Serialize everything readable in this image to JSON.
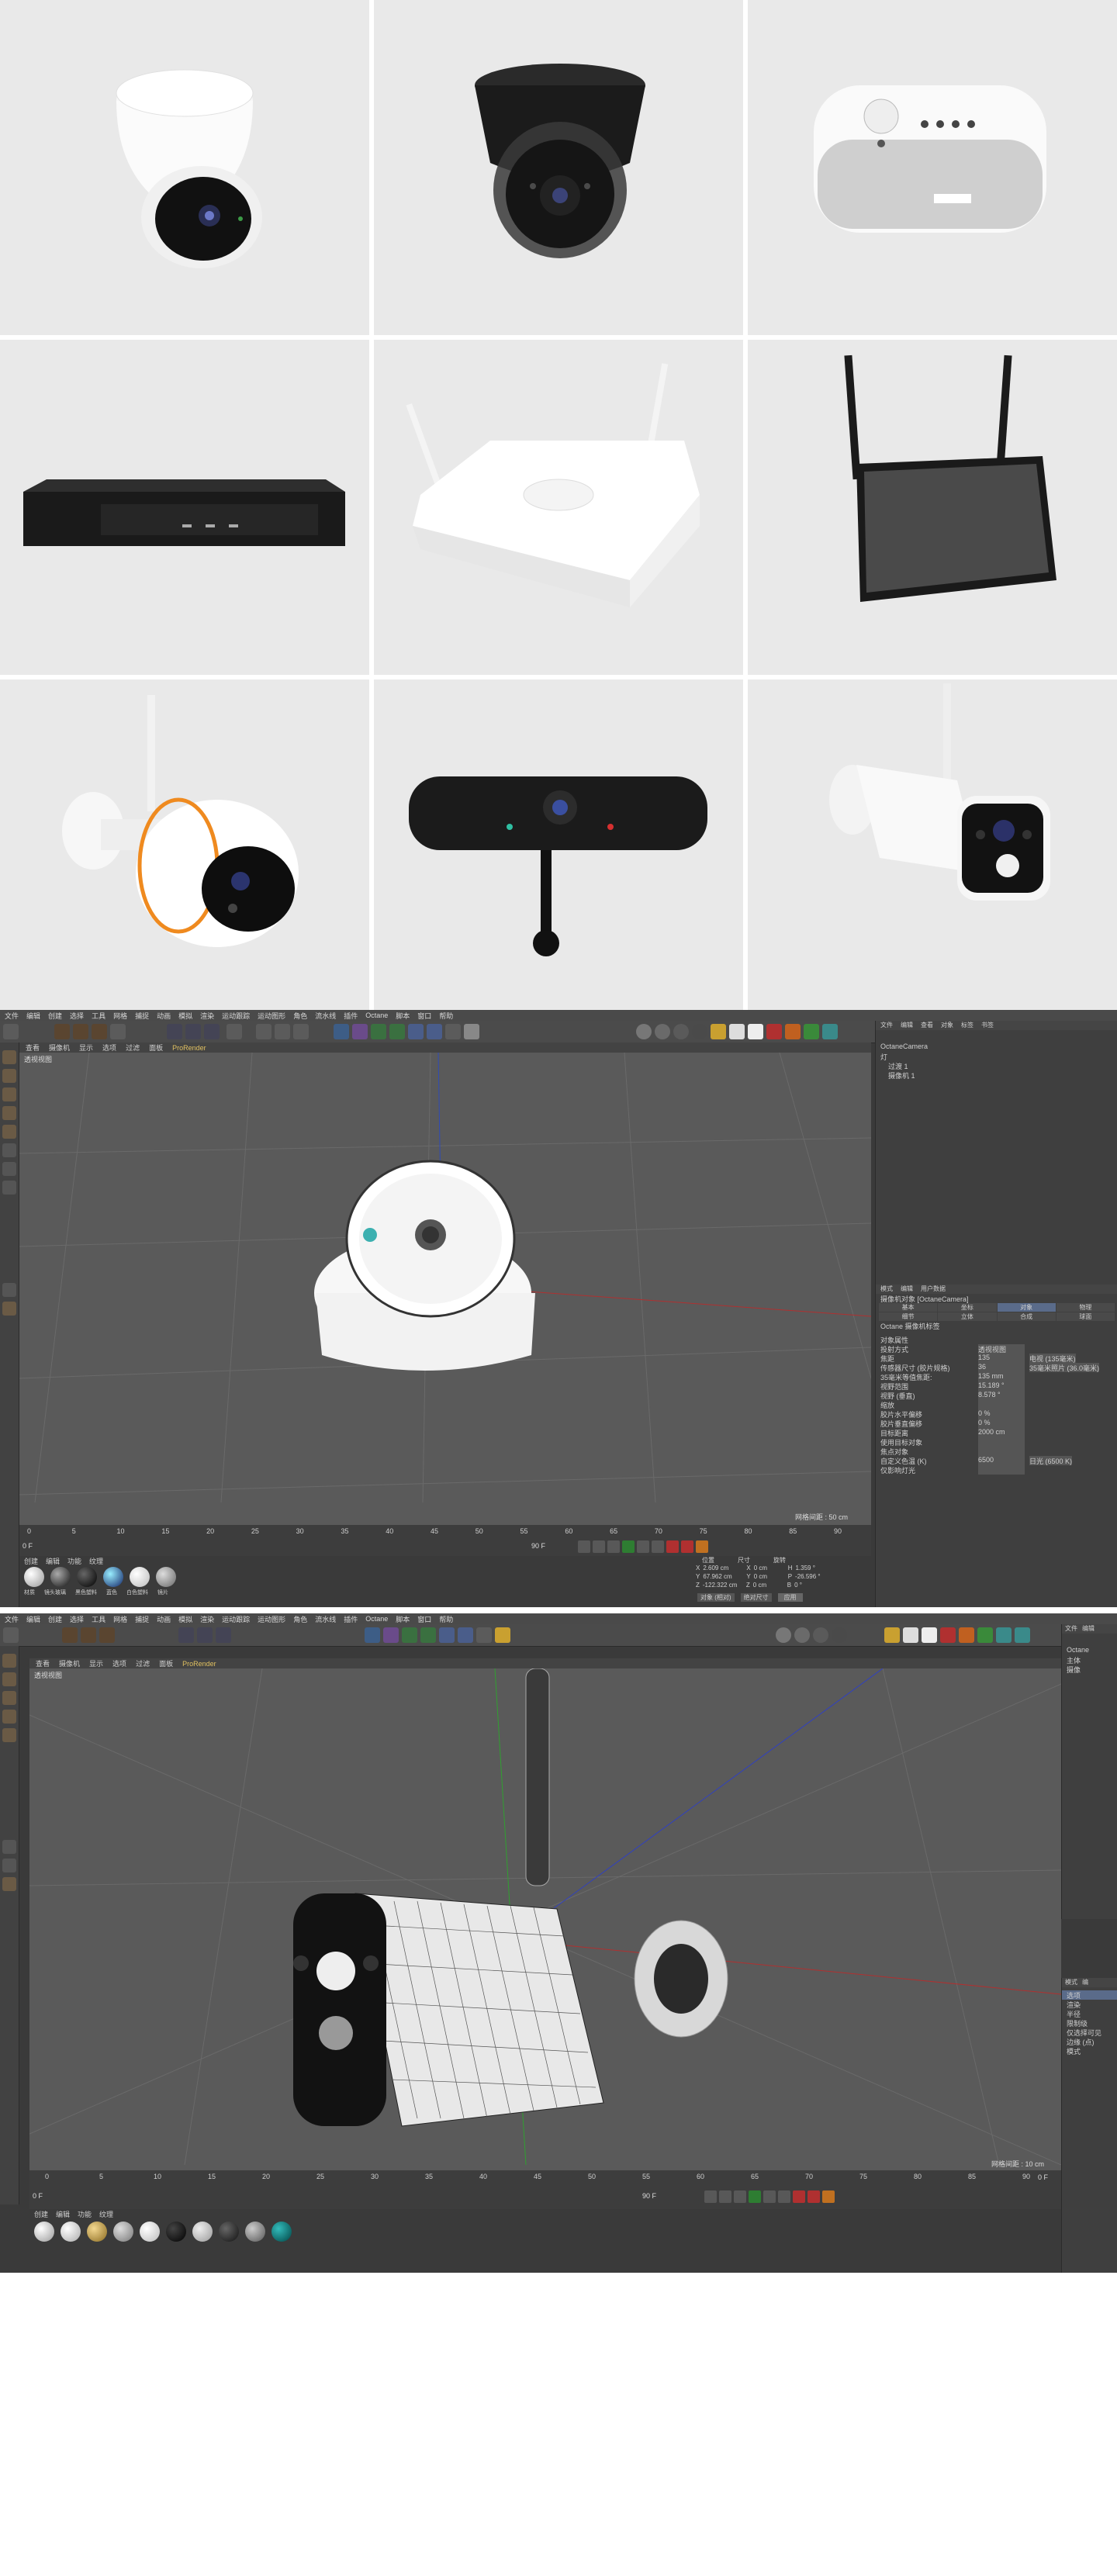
{
  "grid": {
    "tiles": [
      {
        "name": "dome-camera-white"
      },
      {
        "name": "dome-camera-black"
      },
      {
        "name": "smart-speaker"
      },
      {
        "name": "nvr-recorder"
      },
      {
        "name": "wifi-nvr-router"
      },
      {
        "name": "monitor-with-antennas"
      },
      {
        "name": "bullet-camera-orange-ring"
      },
      {
        "name": "webcam"
      },
      {
        "name": "bullet-camera-pir"
      }
    ]
  },
  "c4d_top": {
    "menu": [
      "文件",
      "编辑",
      "创建",
      "选择",
      "工具",
      "网格",
      "捕捉",
      "动画",
      "模拟",
      "渲染",
      "运动跟踪",
      "运动图形",
      "角色",
      "流水线",
      "插件",
      "Octane",
      "脚本",
      "窗口",
      "帮助"
    ],
    "viewport_menu": [
      "查看",
      "摄像机",
      "显示",
      "选项",
      "过滤",
      "面板",
      "ProRender"
    ],
    "viewport_label": "透视视图",
    "grid_spacing": "网格间距 : 50 cm",
    "timeline_ticks": [
      "0",
      "5",
      "10",
      "15",
      "20",
      "25",
      "30",
      "35",
      "40",
      "45",
      "50",
      "55",
      "60",
      "65",
      "70",
      "75",
      "80",
      "85",
      "90"
    ],
    "frame_start": "0 F",
    "frame_end": "90 F",
    "frame_current": "0 F",
    "frame_end2": "90 F",
    "material_tabs": [
      "创建",
      "编辑",
      "功能",
      "纹理"
    ],
    "materials": [
      "材质",
      "镜头玻璃",
      "黑色塑料",
      "蓝色",
      "白色塑料",
      "镜片"
    ],
    "coords": {
      "header": [
        "位置",
        "尺寸",
        "旋转"
      ],
      "rows": [
        [
          "X",
          "2.609 cm",
          "X",
          "0 cm",
          "H",
          "1.359 °"
        ],
        [
          "Y",
          "67.962 cm",
          "Y",
          "0 cm",
          "P",
          "-26.596 °"
        ],
        [
          "Z",
          "-122.322 cm",
          "Z",
          "0 cm",
          "B",
          "0 °"
        ]
      ],
      "mode": "对象 (相对)",
      "size_mode": "绝对尺寸",
      "apply": "应用"
    },
    "objects_menu": [
      "文件",
      "编辑",
      "查看",
      "对象",
      "标签",
      "书签"
    ],
    "objects": [
      "OctaneCamera",
      "灯",
      "过渡 1",
      "摄像机 1"
    ],
    "attr_menu": [
      "模式",
      "编辑",
      "用户数据"
    ],
    "attr_title": "摄像机对象 [OctaneCamera]",
    "attr_tabs": [
      "基本",
      "坐标",
      "对象",
      "物理",
      "细节",
      "立体",
      "合成",
      "球面"
    ],
    "attr_subtab": "Octane 摄像机标签",
    "attr_section": "对象属性",
    "attr_rows": [
      {
        "label": "投射方式",
        "value": "透视视图"
      },
      {
        "label": "焦距",
        "value": "135",
        "extra": "电视 (135毫米)"
      },
      {
        "label": "传感器尺寸 (胶片规格)",
        "value": "36",
        "extra": "35毫米照片 (36.0毫米)"
      },
      {
        "label": "35毫米等值焦距:",
        "value": "135 mm"
      },
      {
        "label": "视野范围",
        "value": "15.189 °"
      },
      {
        "label": "视野 (垂直)",
        "value": "8.578 °"
      },
      {
        "label": "缩放",
        "value": ""
      },
      {
        "label": "胶片水平偏移",
        "value": "0 %"
      },
      {
        "label": "胶片垂直偏移",
        "value": "0 %"
      },
      {
        "label": "目标距离",
        "value": "2000 cm"
      },
      {
        "label": "使用目标对象",
        "value": ""
      },
      {
        "label": "焦点对象",
        "value": ""
      },
      {
        "label": "自定义色温 (K)",
        "value": "6500",
        "extra": "日光 (6500 K)"
      },
      {
        "label": "仅影响灯光",
        "value": ""
      }
    ]
  },
  "c4d_bottom": {
    "menu": [
      "文件",
      "编辑",
      "创建",
      "选择",
      "工具",
      "网格",
      "捕捉",
      "动画",
      "模拟",
      "渲染",
      "运动跟踪",
      "运动图形",
      "角色",
      "流水线",
      "插件",
      "Octane",
      "脚本",
      "窗口",
      "帮助"
    ],
    "viewport_menu": [
      "查看",
      "摄像机",
      "显示",
      "选项",
      "过滤",
      "面板",
      "ProRender"
    ],
    "viewport_label": "透视视图",
    "grid_spacing": "网格间距 : 10 cm",
    "timeline_ticks": [
      "0",
      "5",
      "10",
      "15",
      "20",
      "25",
      "30",
      "35",
      "40",
      "45",
      "50",
      "55",
      "60",
      "65",
      "70",
      "75",
      "80",
      "85",
      "90"
    ],
    "frame_start": "0 F",
    "frame_end": "90 F",
    "frame_current": "0 F",
    "frame_end2": "90 F",
    "frame_right": "0 F",
    "material_tabs": [
      "创建",
      "编辑",
      "功能",
      "纹理"
    ],
    "objects_menu": [
      "文件",
      "编辑"
    ],
    "objects": [
      "Octane",
      "主体",
      "摄像"
    ],
    "attr_menu": [
      "模式",
      "编"
    ],
    "attr_tabs": [
      "选项"
    ],
    "attr_rows": [
      "渲染",
      "半径",
      "限制级",
      "仅选择可见",
      "边缘 (点)",
      "模式"
    ]
  }
}
